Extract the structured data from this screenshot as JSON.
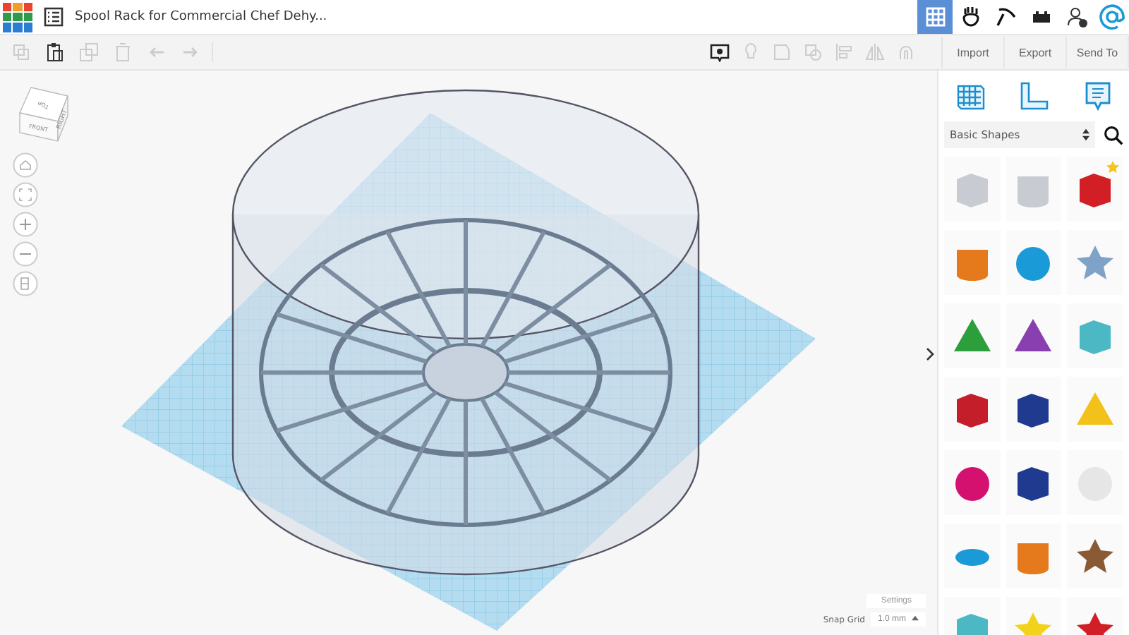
{
  "header": {
    "title": "Spool Rack for Commercial Chef Dehy..."
  },
  "toolbar": {
    "actions": [
      "Import",
      "Export",
      "Send To"
    ]
  },
  "view_cube": {
    "faces": [
      "TOP",
      "FRONT",
      "RIGHT"
    ]
  },
  "library": {
    "category": "Basic Shapes"
  },
  "workplane": {
    "settings": "Settings",
    "snap_label": "Snap Grid",
    "snap_value": "1.0 mm"
  },
  "shapes": [
    {
      "kind": "box-hole",
      "favorite": false
    },
    {
      "kind": "cylinder-hole",
      "favorite": false
    },
    {
      "kind": "box",
      "favorite": true
    },
    {
      "kind": "cylinder",
      "favorite": false
    },
    {
      "kind": "sphere",
      "favorite": false
    },
    {
      "kind": "scribble",
      "favorite": false
    },
    {
      "kind": "roof",
      "favorite": false
    },
    {
      "kind": "cone",
      "favorite": false
    },
    {
      "kind": "round-roof",
      "favorite": false
    },
    {
      "kind": "text",
      "favorite": false
    },
    {
      "kind": "wedge",
      "favorite": false
    },
    {
      "kind": "pyramid",
      "favorite": false
    },
    {
      "kind": "half-sphere",
      "favorite": false
    },
    {
      "kind": "polygon",
      "favorite": false
    },
    {
      "kind": "paraboloid",
      "favorite": false
    },
    {
      "kind": "torus",
      "favorite": false
    },
    {
      "kind": "tube",
      "favorite": false
    },
    {
      "kind": "heart",
      "favorite": false
    },
    {
      "kind": "burst",
      "favorite": false
    },
    {
      "kind": "star",
      "favorite": false
    },
    {
      "kind": "gem",
      "favorite": false
    }
  ]
}
